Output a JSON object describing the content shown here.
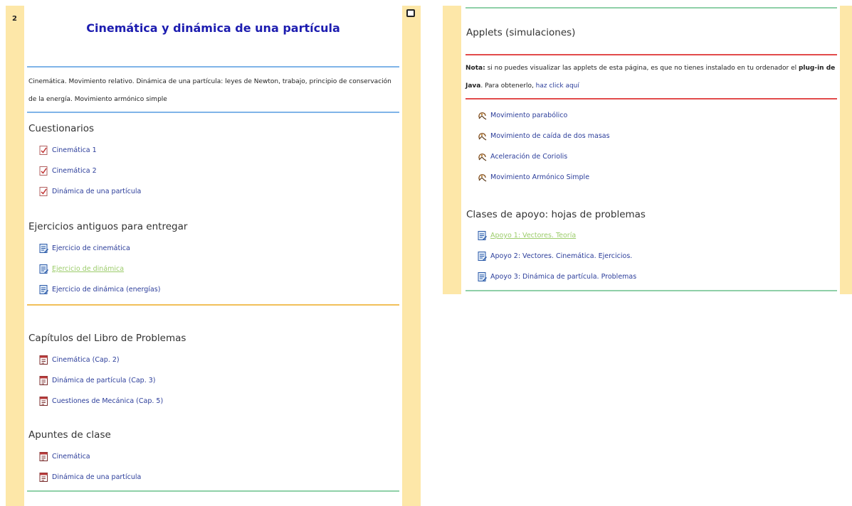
{
  "section": {
    "number": "2",
    "title": "Cinemática y dinámica de una partícula",
    "summary": "Cinemática. Movimiento relativo. Dinámica de una partícula: leyes de Newton, trabajo, principio de conservación de la energía. Movimiento armónico simple"
  },
  "cuestionarios": {
    "heading": "Cuestionarios",
    "items": [
      "Cinemática 1",
      "Cinemática 2",
      "Dinámica de una partícula"
    ]
  },
  "ejercicios": {
    "heading": "Ejercicios antiguos para entregar",
    "items": [
      "Ejercicio de cinemática",
      "Ejercicio de dinámica",
      "Ejercicio de dinámica (energías)"
    ]
  },
  "libro": {
    "heading": "Capítulos del Libro de Problemas",
    "items": [
      "Cinemática (Cap. 2)",
      "Dinámica de partícula (Cap. 3)",
      "Cuestiones de Mecánica (Cap. 5)"
    ]
  },
  "apuntes": {
    "heading": "Apuntes de clase",
    "items": [
      "Cinemática",
      "Dinámica de una partícula"
    ]
  },
  "applets": {
    "heading": "Applets (simulaciones)",
    "note": {
      "label": "Nota:",
      "text1": " si no puedes visualizar las applets de esta página, es que no tienes instalado en tu ordenador el ",
      "bold": "plug-in de Java",
      "text2": ". Para obtenerlo, ",
      "link": "haz click aquí"
    },
    "items": [
      "Movimiento parabólico",
      "Movimiento de caída de dos masas",
      "Aceleración de Coriolis",
      "Movimiento Armónico Simple"
    ]
  },
  "apoyo": {
    "heading": "Clases de apoyo: hojas de problemas",
    "items": [
      "Apoyo 1: Vectores. Teoría",
      "Apoyo 2: Vectores. Cinemática. Ejercicios.",
      "Apoyo 3: Dinámica de partícula. Problemas"
    ]
  },
  "colors": {
    "title": "#1d1db0",
    "link": "#2b3d9a",
    "visited_link": "#9ccc6b",
    "side_bar": "#fde7a8",
    "divider_blue": "#7fb4e8",
    "divider_orange": "#f1bf5a",
    "divider_green": "#8fd0a8",
    "divider_red": "#e24b4b"
  }
}
